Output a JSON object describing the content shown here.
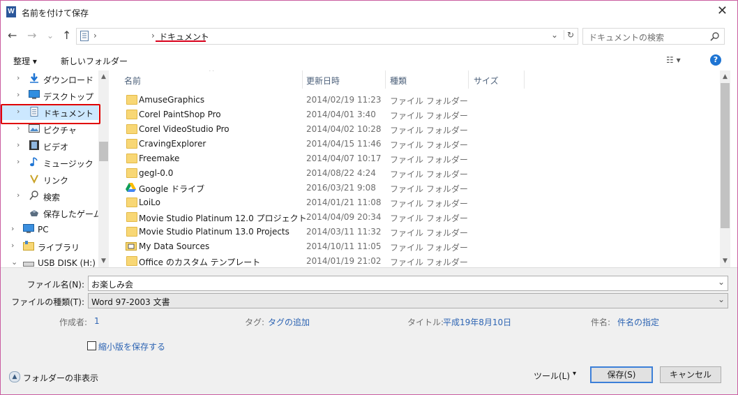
{
  "window": {
    "title": "名前を付けて保存",
    "app_icon": "W"
  },
  "nav_buttons": {
    "back": "←",
    "forward": "→",
    "recent": "⌄",
    "up": "↑"
  },
  "address": {
    "root_sep": "›",
    "location": "ドキュメント",
    "trail_sep": "›",
    "dropdown": "⌄",
    "refresh": "↻"
  },
  "search": {
    "placeholder": "ドキュメントの検索"
  },
  "toolbar": {
    "organize": "整理 ▾",
    "new_folder": "新しいフォルダー",
    "view": "☷ ▾",
    "help": "?"
  },
  "nav_pane": {
    "items": [
      {
        "label": "ダウンロード",
        "icon": "download-arrow-icon"
      },
      {
        "label": "デスクトップ",
        "icon": "desktop-icon"
      },
      {
        "label": "ドキュメント",
        "icon": "document-icon",
        "selected": true
      },
      {
        "label": "ピクチャ",
        "icon": "pictures-icon"
      },
      {
        "label": "ビデオ",
        "icon": "video-icon"
      },
      {
        "label": "ミュージック",
        "icon": "music-note-icon"
      },
      {
        "label": "リンク",
        "icon": "link-icon"
      },
      {
        "label": "検索",
        "icon": "search-icon"
      },
      {
        "label": "保存したゲーム",
        "icon": "game-icon"
      },
      {
        "label": "PC",
        "icon": "pc-icon"
      },
      {
        "label": "ライブラリ",
        "icon": "library-icon"
      },
      {
        "label": "USB DISK (H:)",
        "icon": "usb-drive-icon"
      }
    ]
  },
  "columns": {
    "name": "名前",
    "date": "更新日時",
    "type": "種類",
    "size": "サイズ"
  },
  "files": [
    {
      "name": "AmuseGraphics",
      "date": "2014/02/19 11:23",
      "type": "ファイル フォルダー"
    },
    {
      "name": "Corel PaintShop Pro",
      "date": "2014/04/01 3:40",
      "type": "ファイル フォルダー"
    },
    {
      "name": "Corel VideoStudio Pro",
      "date": "2014/04/02 10:28",
      "type": "ファイル フォルダー"
    },
    {
      "name": "CravingExplorer",
      "date": "2014/04/15 11:46",
      "type": "ファイル フォルダー"
    },
    {
      "name": "Freemake",
      "date": "2014/04/07 10:17",
      "type": "ファイル フォルダー"
    },
    {
      "name": "gegl-0.0",
      "date": "2014/08/22 4:24",
      "type": "ファイル フォルダー"
    },
    {
      "name": "Google ドライブ",
      "date": "2016/03/21 9:08",
      "type": "ファイル フォルダー"
    },
    {
      "name": "LoiLo",
      "date": "2014/01/21 11:08",
      "type": "ファイル フォルダー"
    },
    {
      "name": "Movie Studio Platinum 12.0 プロジェクト",
      "date": "2014/04/09 20:34",
      "type": "ファイル フォルダー"
    },
    {
      "name": "Movie Studio Platinum 13.0 Projects",
      "date": "2014/03/11 11:32",
      "type": "ファイル フォルダー"
    },
    {
      "name": "My Data Sources",
      "date": "2014/10/11 11:05",
      "type": "ファイル フォルダー"
    },
    {
      "name": "Office のカスタム テンプレート",
      "date": "2014/01/19 21:02",
      "type": "ファイル フォルダー"
    }
  ],
  "form": {
    "filename_label": "ファイル名(N):",
    "filename_value": "お楽しみ会",
    "filetype_label": "ファイルの種類(T):",
    "filetype_value": "Word 97-2003 文書",
    "author_label": "作成者:",
    "author_value": "1",
    "tags_label": "タグ:",
    "tags_value": "タグの追加",
    "title_label": "タイトル:",
    "title_value": "平成19年8月10日",
    "subject_label": "件名:",
    "subject_value": "件名の指定",
    "thumbnail_label": "縮小版を保存する",
    "hide_folders": "フォルダーの非表示",
    "tools": "ツール(L)",
    "tools_arrow": "▾",
    "save": "保存(S)",
    "cancel": "キャンセル"
  },
  "colors": {
    "accent": "#3c7fd8",
    "selected_bg": "#cce8ff",
    "highlight_red": "#e00000"
  }
}
